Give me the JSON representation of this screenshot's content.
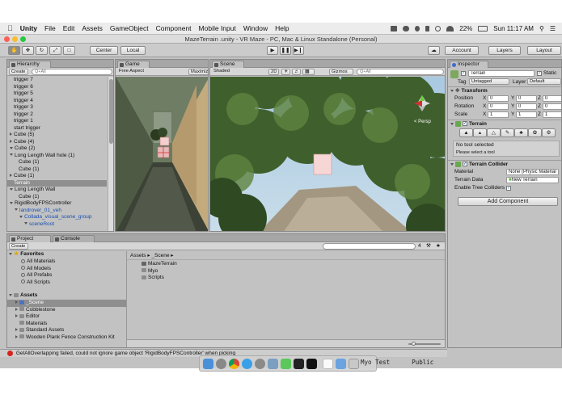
{
  "menubar": {
    "app": "Unity",
    "items": [
      "File",
      "Edit",
      "Assets",
      "GameObject",
      "Component",
      "Mobile Input",
      "Window",
      "Help"
    ],
    "battery": "22%",
    "clock": "Sun 11:17 AM"
  },
  "window": {
    "title": "MazeTerrain .unity - VR Maze - PC, Mac & Linux Standalone (Personal)"
  },
  "toolbar": {
    "pivot": "Center",
    "space": "Local",
    "account": "Account",
    "layers": "Layers",
    "layout": "Layout"
  },
  "hierarchy": {
    "tab": "Hierarchy",
    "create": "Create",
    "search_placeholder": "Q+All",
    "items": [
      {
        "label": "trigger 7",
        "indent": 0,
        "arrow": "none",
        "selected": false
      },
      {
        "label": "trigger 6",
        "indent": 0,
        "arrow": "none",
        "selected": false
      },
      {
        "label": "trigger 5",
        "indent": 0,
        "arrow": "none",
        "selected": false
      },
      {
        "label": "trigger 4",
        "indent": 0,
        "arrow": "none",
        "selected": false
      },
      {
        "label": "trigger 3",
        "indent": 0,
        "arrow": "none",
        "selected": false
      },
      {
        "label": "trigger 2",
        "indent": 0,
        "arrow": "none",
        "selected": false
      },
      {
        "label": "trigger 1",
        "indent": 0,
        "arrow": "none",
        "selected": false
      },
      {
        "label": "start trigger",
        "indent": 0,
        "arrow": "none",
        "selected": false
      },
      {
        "label": "Cube (5)",
        "indent": 0,
        "arrow": "right",
        "selected": false
      },
      {
        "label": "Cube (4)",
        "indent": 0,
        "arrow": "right",
        "selected": false
      },
      {
        "label": "Cube (2)",
        "indent": 0,
        "arrow": "down",
        "selected": false
      },
      {
        "label": "Long Length Wall hole (1)",
        "indent": 0,
        "arrow": "down",
        "selected": false
      },
      {
        "label": "Cube (1)",
        "indent": 1,
        "arrow": "none",
        "selected": false
      },
      {
        "label": "Cube (1)",
        "indent": 1,
        "arrow": "none",
        "selected": false
      },
      {
        "label": "Cube (1)",
        "indent": 0,
        "arrow": "right",
        "selected": false
      },
      {
        "label": "Terrain",
        "indent": 0,
        "arrow": "none",
        "selected": true
      },
      {
        "label": "Long Length Wall",
        "indent": 0,
        "arrow": "down",
        "selected": false
      },
      {
        "label": "Cube (1)",
        "indent": 1,
        "arrow": "none",
        "selected": false
      },
      {
        "label": "RigidBodyFPSController",
        "indent": 0,
        "arrow": "down",
        "selected": false
      },
      {
        "label": "landrover_01_veh",
        "indent": 1,
        "arrow": "down",
        "selected": false
      },
      {
        "label": "Collada_visual_scene_group",
        "indent": 2,
        "arrow": "down",
        "selected": false
      },
      {
        "label": "sceneRoot",
        "indent": 3,
        "arrow": "down",
        "selected": false
      }
    ]
  },
  "game": {
    "tab": "Game",
    "aspect": "Free Aspect",
    "maximize": "Maximiz"
  },
  "scene": {
    "tab": "Scene",
    "shading": "Shaded",
    "mode2d": "2D",
    "gizmos": "Gizmos",
    "search_placeholder": "Q+All",
    "gizmo_label": "< Persp"
  },
  "project": {
    "tab_project": "Project",
    "tab_console": "Console",
    "create": "Create",
    "favorites_header": "Favorites",
    "favorites": [
      "All Materials",
      "All Models",
      "All Prefabs",
      "All Scripts"
    ],
    "assets_header": "Assets",
    "assets_tree": [
      {
        "label": "_Scene",
        "selected": true
      },
      {
        "label": "Cobblestone",
        "selected": false
      },
      {
        "label": "Editor",
        "selected": false
      },
      {
        "label": "Materials",
        "selected": false
      },
      {
        "label": "Standard Assets",
        "selected": false
      },
      {
        "label": "Wooden Plank Fence Construction Kit",
        "selected": false
      }
    ],
    "breadcrumb_root": "Assets",
    "breadcrumb_current": "_Scene",
    "files": [
      "MazeTerrain",
      "Myo",
      "Scripts"
    ],
    "count": "4"
  },
  "inspector": {
    "tab": "Inspector",
    "object_name": "Terrain",
    "static_label": "Static",
    "tag_label": "Tag",
    "tag_value": "Untagged",
    "layer_label": "Layer",
    "layer_value": "Default",
    "transform_title": "Transform",
    "transform": [
      {
        "label": "Position",
        "x": "0",
        "y": "0",
        "z": "0"
      },
      {
        "label": "Rotation",
        "x": "0",
        "y": "0",
        "z": "0"
      },
      {
        "label": "Scale",
        "x": "1",
        "y": "1",
        "z": "1"
      }
    ],
    "axis_x": "X",
    "axis_y": "Y",
    "axis_z": "Z",
    "terrain_title": "Terrain",
    "no_tool": "No tool selected",
    "select_tool": "Please select a tool",
    "collider_title": "Terrain Collider",
    "material_label": "Material",
    "material_value": "None (Physic Material",
    "terrain_data_label": "Terrain Data",
    "terrain_data_value": "New Terrain",
    "enable_trees_label": "Enable Tree Colliders",
    "add_component": "Add Component"
  },
  "statusbar": {
    "message": "GetAllOverlapping failed, could not ignore game object 'RigidBodyFPSController' when picking"
  },
  "terminal": {
    "col1": "Myo Test",
    "col2": "Public"
  },
  "colors": {
    "selection": "#8f8f8f",
    "accent_blue": "#3d6dcc",
    "error_red": "#d6231b"
  }
}
